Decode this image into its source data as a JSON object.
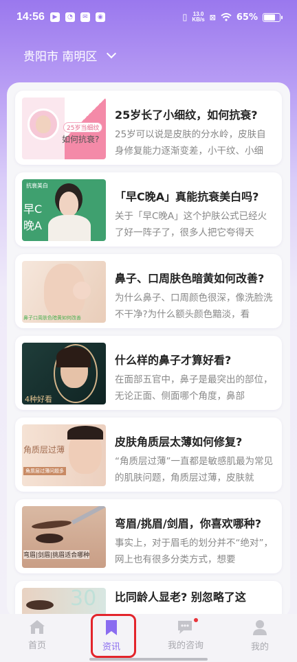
{
  "status_bar": {
    "time": "14:56",
    "net_speed_value": "13.0",
    "net_speed_unit": "KB/s",
    "battery": "65%"
  },
  "location": {
    "city": "贵阳市 南明区"
  },
  "articles": [
    {
      "title": "25岁长了小细纹，如何抗衰?",
      "desc": "25岁可以说是皮肤的分水岭，皮肤自身修复能力逐渐变差，小干纹、小细",
      "thumb_text_1": "25岁当细纹",
      "thumb_text_2": "如何抗衰?"
    },
    {
      "title": "「早C晚A」真能抗衰美白吗?",
      "desc": "关于「早C晚A」这个护肤公式已经火了好一阵子了，很多人把它夸得天",
      "thumb_text_1": "抗衰美白",
      "thumb_text_2": "早C",
      "thumb_text_3": "晚A"
    },
    {
      "title": "鼻子、口周肤色暗黄如何改善?",
      "desc": "为什么鼻子、口周颜色很深，像洗脸洗不干净?为什么额头颜色黯淡，看",
      "thumb_text_1": "鼻子口周肤色暗黄如何改善"
    },
    {
      "title": "什么样的鼻子才算好看?",
      "desc": "在面部五官中，鼻子是最突出的部位，无论正面、侧面哪个角度，鼻部",
      "thumb_text_1": "4种好看"
    },
    {
      "title": "皮肤角质层太薄如何修复?",
      "desc": "“角质层过薄”一直都是敏感肌最为常见的肌肤问题，角质层过薄，皮肤就",
      "thumb_text_1": "角质层过薄",
      "thumb_text_2": "角质层过薄问题多"
    },
    {
      "title": "弯眉/挑眉/剑眉，你喜欢哪种?",
      "desc": "事实上，对于眉毛的划分并不“绝对”，网上也有很多分类方式，想要",
      "thumb_text_1": "弯眉|剑眉|挑眉适合哪种"
    },
    {
      "title": "比同龄人显老? 别忽略了这",
      "desc": "",
      "thumb_text_1": "30"
    }
  ],
  "tabs": [
    {
      "label": "首页",
      "icon": "home-icon"
    },
    {
      "label": "资讯",
      "icon": "bookmark-icon",
      "active": true
    },
    {
      "label": "我的咨询",
      "icon": "chat-icon"
    },
    {
      "label": "我的",
      "icon": "user-icon"
    }
  ],
  "colors": {
    "accent": "#8a6cf0",
    "header_gradient_top": "#9a78ee",
    "highlight": "#e3242b",
    "badge": "#e8343a"
  }
}
